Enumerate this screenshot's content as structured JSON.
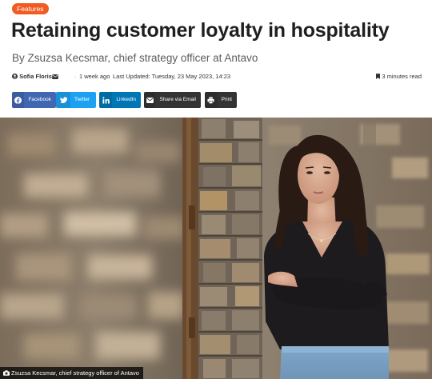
{
  "article": {
    "category": "Features",
    "title": "Retaining customer loyalty in hospitality",
    "subtitle": "By Zsuzsa Kecsmar, chief strategy officer at Antavo"
  },
  "meta": {
    "author": "Sofia Floris",
    "posted_ago": "1 week ago",
    "last_updated": "Last Updated: Tuesday, 23 May 2023, 14:23",
    "read_time": "3 minutes read"
  },
  "share": [
    {
      "label": "Facebook",
      "icon": "facebook-icon",
      "color": "#4267b2"
    },
    {
      "label": "Twitter",
      "icon": "twitter-icon",
      "color": "#1da1f2"
    },
    {
      "label": "LinkedIn",
      "icon": "linkedin-icon",
      "color": "#0077b5"
    },
    {
      "label": "Share via Email",
      "icon": "email-icon",
      "color": "#333333"
    },
    {
      "label": "Print",
      "icon": "print-icon",
      "color": "#333333"
    }
  ],
  "image": {
    "caption": "Zsuzsa Kecsmar, chief strategy officer of Antavo"
  },
  "colors": {
    "accent": "#f15a22",
    "text": "#1f1f1f",
    "muted": "#5c5c5c"
  }
}
